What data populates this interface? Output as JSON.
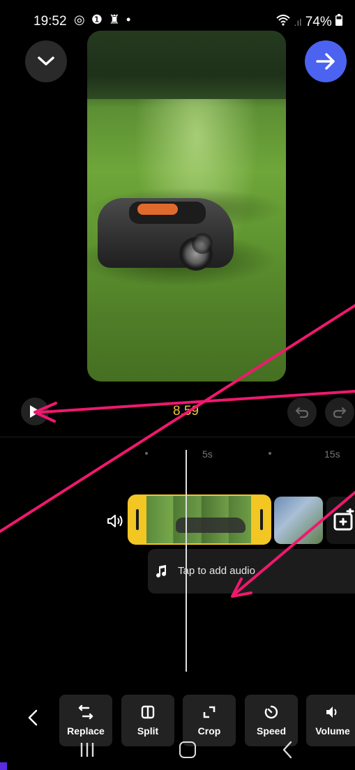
{
  "status_bar": {
    "time": "19:52",
    "icons": "◎ ❶ ♜ •",
    "battery": "74%",
    "battery_icon": "battery-icon",
    "wifi_icon": "wifi-icon"
  },
  "editor": {
    "current_time": "8.59"
  },
  "ruler": {
    "labels": [
      "5s",
      "15s"
    ]
  },
  "audio": {
    "placeholder": "Tap to add audio"
  },
  "toolbar": {
    "items": [
      {
        "label": "Replace",
        "icon": "replace-icon"
      },
      {
        "label": "Split",
        "icon": "split-icon"
      },
      {
        "label": "Crop",
        "icon": "crop-icon"
      },
      {
        "label": "Speed",
        "icon": "speed-icon"
      },
      {
        "label": "Volume",
        "icon": "volume-icon"
      }
    ]
  },
  "colors": {
    "accent_blue": "#4b63f0",
    "clip_selected": "#f2c623",
    "time_label": "#f0c23a",
    "annotation": "#f0186e"
  }
}
